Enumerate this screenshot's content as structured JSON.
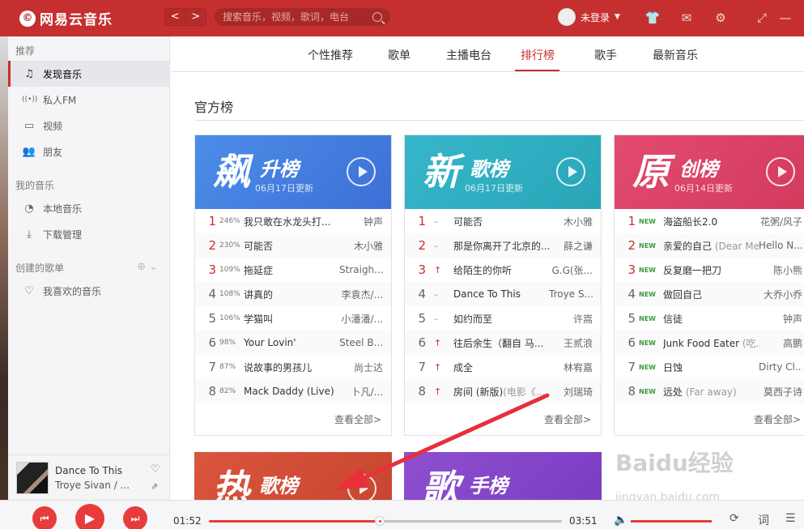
{
  "header": {
    "app_name": "网易云音乐",
    "logo_glyph": "©",
    "back_glyph": "<",
    "forward_glyph": ">",
    "search_placeholder": "搜索音乐，视频，歌词，电台",
    "user_label": "未登录",
    "caret_glyph": "▼",
    "icons": [
      "shirt-icon",
      "mail-icon",
      "settings-icon",
      "mini-mode-icon",
      "minimize-icon"
    ],
    "icon_glyphs": [
      "👕",
      "✉",
      "⚙",
      "⤢",
      "—"
    ]
  },
  "sidebar": {
    "section_recommend": "推荐",
    "recommend_items": [
      {
        "label": "发现音乐",
        "icon": "music-note-icon",
        "glyph": "♫"
      },
      {
        "label": "私人FM",
        "icon": "radio-icon",
        "glyph": "((•))"
      },
      {
        "label": "视频",
        "icon": "video-icon",
        "glyph": "▭"
      },
      {
        "label": "朋友",
        "icon": "friends-icon",
        "glyph": "👥"
      }
    ],
    "section_my_music": "我的音乐",
    "my_music_items": [
      {
        "label": "本地音乐",
        "icon": "local-music-icon",
        "glyph": "◔"
      },
      {
        "label": "下载管理",
        "icon": "download-icon",
        "glyph": "⤓"
      }
    ],
    "section_created": "创建的歌单",
    "created_plus_glyph": "⊕ ⌄",
    "created_items": [
      {
        "label": "我喜欢的音乐",
        "icon": "heart-icon",
        "glyph": "♡"
      }
    ]
  },
  "now_playing": {
    "title": "Dance To This",
    "artist": "Troye Sivan / ...",
    "heart_glyph": "♡",
    "share_glyph": "⇗"
  },
  "tabs": [
    "个性推荐",
    "歌单",
    "主播电台",
    "排行榜",
    "歌手",
    "最新音乐"
  ],
  "active_tab": "排行榜",
  "section_title": "官方榜",
  "boards": [
    {
      "big": "飙",
      "small": "升榜",
      "date": "06月17日更新",
      "color_from": "#4b8ee8",
      "color_to": "#3e6fd6",
      "more": "查看全部>",
      "rows": [
        {
          "rank": "1",
          "chg": "246%",
          "song": "我只敢在水龙头打...",
          "alias": "",
          "artist": "钟声"
        },
        {
          "rank": "2",
          "chg": "230%",
          "song": "可能否",
          "alias": "",
          "artist": "木小雅"
        },
        {
          "rank": "3",
          "chg": "109%",
          "song": "拖延症",
          "alias": "",
          "artist": "Straigh..."
        },
        {
          "rank": "4",
          "chg": "108%",
          "song": "讲真的",
          "alias": "",
          "artist": "李袁杰/..."
        },
        {
          "rank": "5",
          "chg": "106%",
          "song": "学猫叫",
          "alias": "",
          "artist": "小潘潘/..."
        },
        {
          "rank": "6",
          "chg": "98%",
          "song": "Your Lovin'",
          "alias": "",
          "artist": "Steel B..."
        },
        {
          "rank": "7",
          "chg": "87%",
          "song": "说故事的男孩儿",
          "alias": "",
          "artist": "尚士达"
        },
        {
          "rank": "8",
          "chg": "82%",
          "song": "Mack Daddy (Live)",
          "alias": "",
          "artist": "卜凡/..."
        }
      ]
    },
    {
      "big": "新",
      "small": "歌榜",
      "date": "06月17日更新",
      "color_from": "#36b7c9",
      "color_to": "#2aa5b8",
      "more": "查看全部>",
      "rows": [
        {
          "rank": "1",
          "chg": "–",
          "song": "可能否",
          "alias": "",
          "artist": "木小雅"
        },
        {
          "rank": "2",
          "chg": "–",
          "song": "那是你离开了北京的...",
          "alias": "",
          "artist": "薛之谦"
        },
        {
          "rank": "3",
          "chg": "↑",
          "song": "给陌生的你听",
          "alias": "",
          "artist": "G.G(张..."
        },
        {
          "rank": "4",
          "chg": "–",
          "song": "Dance To This",
          "alias": "",
          "artist": "Troye S..."
        },
        {
          "rank": "5",
          "chg": "–",
          "song": "如约而至",
          "alias": "",
          "artist": "许嵩"
        },
        {
          "rank": "6",
          "chg": "↑",
          "song": "往后余生（翻自 马...",
          "alias": "",
          "artist": "王贰浪"
        },
        {
          "rank": "7",
          "chg": "↑",
          "song": "成全",
          "alias": "",
          "artist": "林宥嘉"
        },
        {
          "rank": "8",
          "chg": "↑",
          "song": "房间 (新版)",
          "alias": "(电影《...",
          "artist": "刘瑞琦"
        }
      ]
    },
    {
      "big": "原",
      "small": "创榜",
      "date": "06月14日更新",
      "color_from": "#e34a6f",
      "color_to": "#d23a5e",
      "more": "查看全部>",
      "rows": [
        {
          "rank": "1",
          "chg": "NEW",
          "song": "海盗船长2.0",
          "alias": "",
          "artist": "花粥/风子"
        },
        {
          "rank": "2",
          "chg": "NEW",
          "song": "亲爱的自己",
          "alias": " (Dear Me)",
          "artist": "Hello N..."
        },
        {
          "rank": "3",
          "chg": "NEW",
          "song": "反复磨一把刀",
          "alias": "",
          "artist": "陈小熊"
        },
        {
          "rank": "4",
          "chg": "NEW",
          "song": "做回自己",
          "alias": "",
          "artist": "大乔小乔"
        },
        {
          "rank": "5",
          "chg": "NEW",
          "song": "信徒",
          "alias": "",
          "artist": "钟声"
        },
        {
          "rank": "6",
          "chg": "NEW",
          "song": "Junk Food Eater",
          "alias": " (吃...",
          "artist": "高鹏"
        },
        {
          "rank": "7",
          "chg": "NEW",
          "song": "日蚀",
          "alias": "",
          "artist": "Dirty Cl..."
        },
        {
          "rank": "8",
          "chg": "NEW",
          "song": "远处",
          "alias": " (Far away)",
          "artist": "莫西子诗"
        }
      ]
    }
  ],
  "boards_second_row": [
    {
      "big": "热",
      "small": "歌榜",
      "color_from": "#d9553d",
      "color_to": "#c8452f"
    },
    {
      "big": "歌",
      "small": "手榜",
      "color_from": "#8e4fd0",
      "color_to": "#7a3dc2"
    }
  ],
  "watermark": {
    "line1": "Baidu经验",
    "line2": "jingyan.baidu.com"
  },
  "player": {
    "current_time": "01:52",
    "total_time": "03:51",
    "progress": 0.485,
    "volume": 1.0,
    "prev_glyph": "⏮",
    "play_glyph": "▶",
    "next_glyph": "⏭",
    "volume_glyph": "🔈",
    "loop_glyph": "⟳",
    "lyric_glyph": "词",
    "playlist_glyph": "☰"
  },
  "colors": {
    "brand": "#c62f2f",
    "accent": "#e83c3c",
    "arrow": "#e8303a"
  }
}
